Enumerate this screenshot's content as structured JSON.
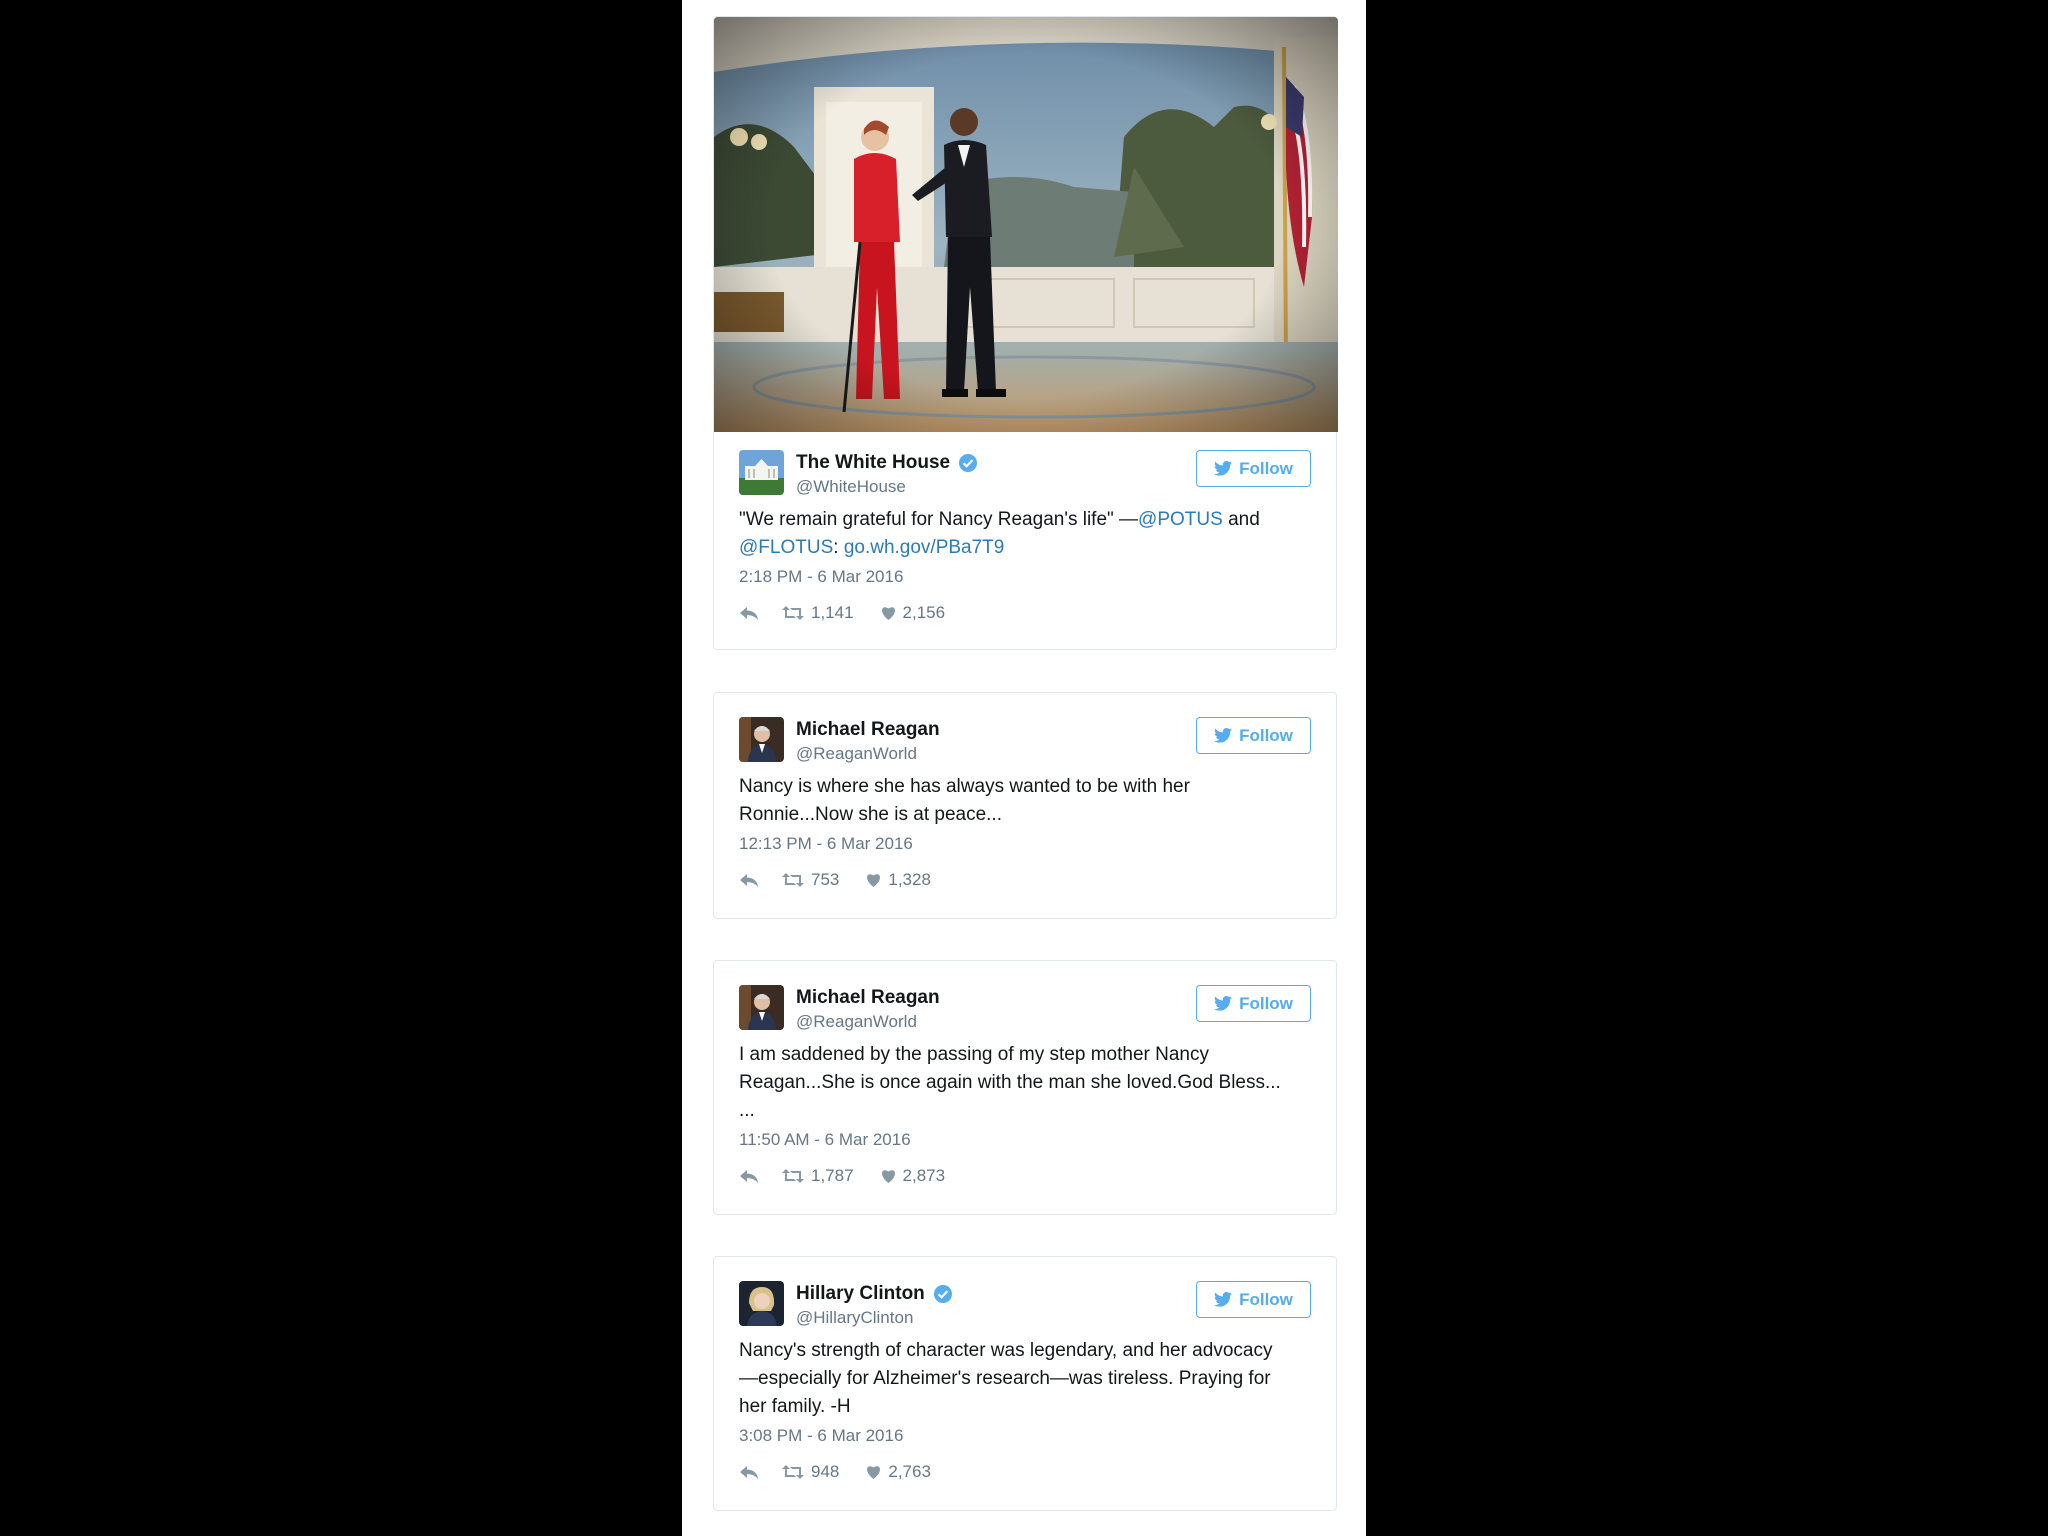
{
  "colors": {
    "link": "#2b7bb9",
    "twitter_blue": "#55acee",
    "muted": "#657786",
    "border": "#e1e8ed",
    "background": "#000000"
  },
  "icons": {
    "verified": "verified-badge-icon",
    "follow": "twitter-bird-icon",
    "reply": "reply-icon",
    "retweet": "retweet-icon",
    "like": "heart-icon"
  },
  "tweets": [
    {
      "author": "The White House",
      "handle": "@WhiteHouse",
      "verified": true,
      "follow_label": "Follow",
      "text_start": "\"We remain grateful for Nancy Reagan's life\" —",
      "mention1": "@POTUS",
      "text_mid": " and ",
      "mention2": "@FLOTUS",
      "text_colon": ": ",
      "link": "go.wh.gov/PBa7T9",
      "time": "2:18 PM - 6 Mar 2016",
      "retweets": "1,141",
      "likes": "2,156"
    },
    {
      "author": "Michael Reagan",
      "handle": "@ReaganWorld",
      "verified": false,
      "follow_label": "Follow",
      "text_line1": "Nancy is where she has always wanted to be with her",
      "text_line2": "Ronnie...Now she is at peace...",
      "time": "12:13 PM - 6 Mar 2016",
      "retweets": "753",
      "likes": "1,328"
    },
    {
      "author": "Michael Reagan",
      "handle": "@ReaganWorld",
      "verified": false,
      "follow_label": "Follow",
      "text_line1": "I am saddened by the passing of my step mother Nancy",
      "text_line2": "Reagan...She is once again with the man she loved.God Bless...",
      "text_line3": "...",
      "time": "11:50 AM - 6 Mar 2016",
      "retweets": "1,787",
      "likes": "2,873"
    },
    {
      "author": "Hillary Clinton",
      "handle": "@HillaryClinton",
      "verified": true,
      "follow_label": "Follow",
      "text_line1": "Nancy's strength of character was legendary, and her advocacy",
      "text_line2": "—especially for Alzheimer's research—was tireless. Praying for",
      "text_line3": "her family. -H",
      "time": "3:08 PM - 6 Mar 2016",
      "retweets": "948",
      "likes": "2,763"
    }
  ]
}
